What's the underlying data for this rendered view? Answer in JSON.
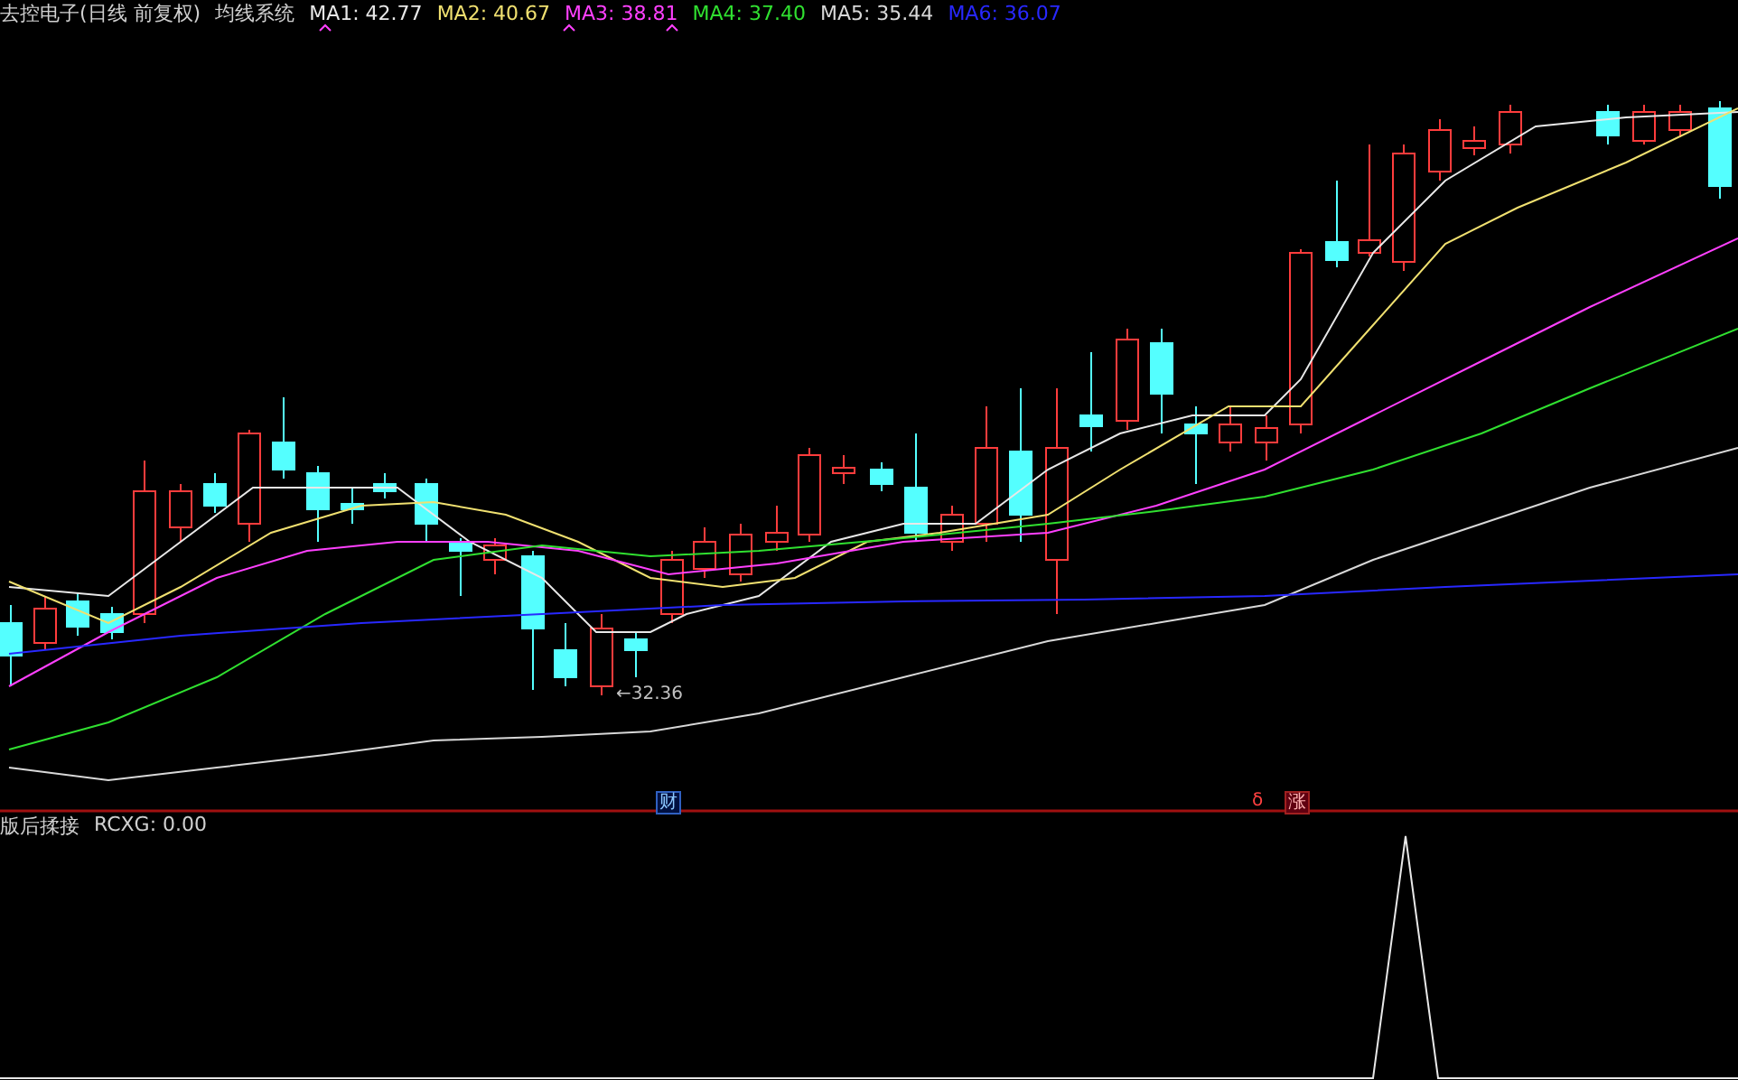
{
  "header": {
    "title": "去控电子(日线 前复权)",
    "indicator": "均线系统",
    "averages": [
      {
        "label": "MA1: 42.77",
        "color": "#e8e8e8"
      },
      {
        "label": "MA2: 40.67",
        "color": "#f0e070"
      },
      {
        "label": "MA3: 38.81",
        "color": "#ff40ff"
      },
      {
        "label": "MA4: 37.40",
        "color": "#30e030"
      },
      {
        "label": "MA5: 35.44",
        "color": "#d8d8d8"
      },
      {
        "label": "MA6: 36.07",
        "color": "#2828ff"
      }
    ]
  },
  "price_label": "←32.36",
  "markers": [
    {
      "kind": "finance",
      "text": "财"
    },
    {
      "kind": "small",
      "text": "δ"
    },
    {
      "kind": "limit",
      "text": "涨"
    }
  ],
  "sub_panel": {
    "name": "版后揉接",
    "reading": "RCXG: 0.00"
  }
}
